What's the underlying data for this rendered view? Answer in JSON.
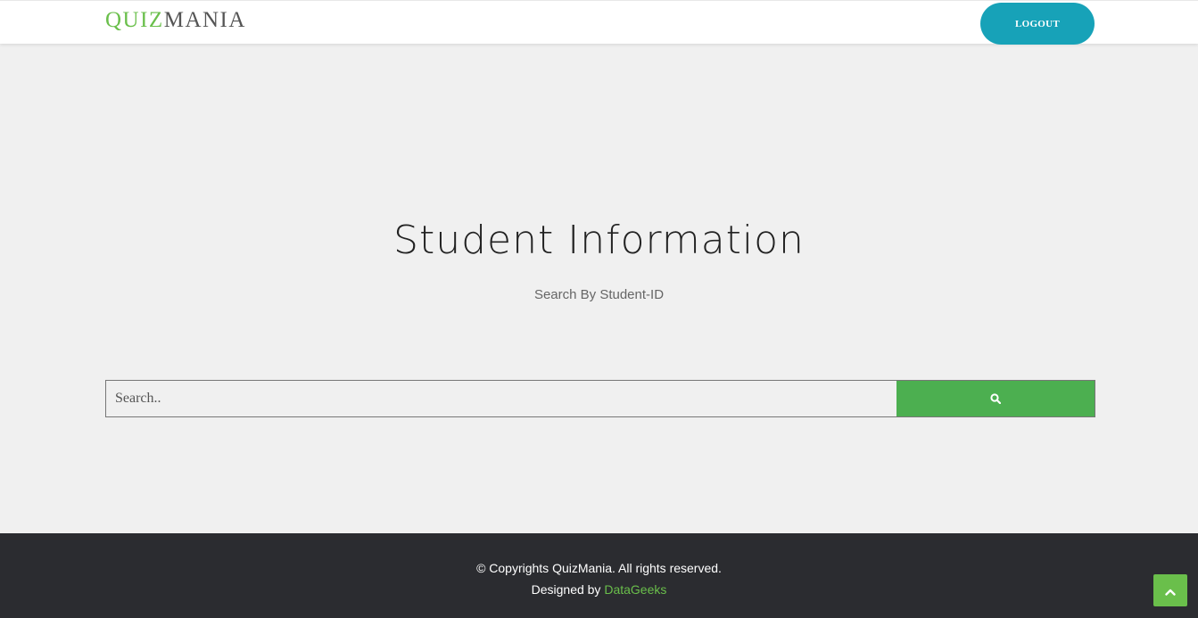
{
  "header": {
    "logo_part1": "QUIZ",
    "logo_part2": "MANIA",
    "logout_label": "LOGOUT"
  },
  "main": {
    "title": "Student Information",
    "subtitle": "Search By Student-ID"
  },
  "search": {
    "placeholder": "Search..",
    "value": "",
    "button_icon": "search-icon"
  },
  "footer": {
    "copyright": "© Copyrights QuizMania. All rights reserved.",
    "designed_prefix": "Designed by ",
    "designed_brand": "DataGeeks",
    "back_to_top_icon": "chevron-up-icon"
  },
  "colors": {
    "brand_green": "#6abf4b",
    "logout_teal": "#17a2b8",
    "search_button_green": "#4caf50",
    "footer_bg": "#2b2c30",
    "page_bg": "#f0f0f0"
  }
}
